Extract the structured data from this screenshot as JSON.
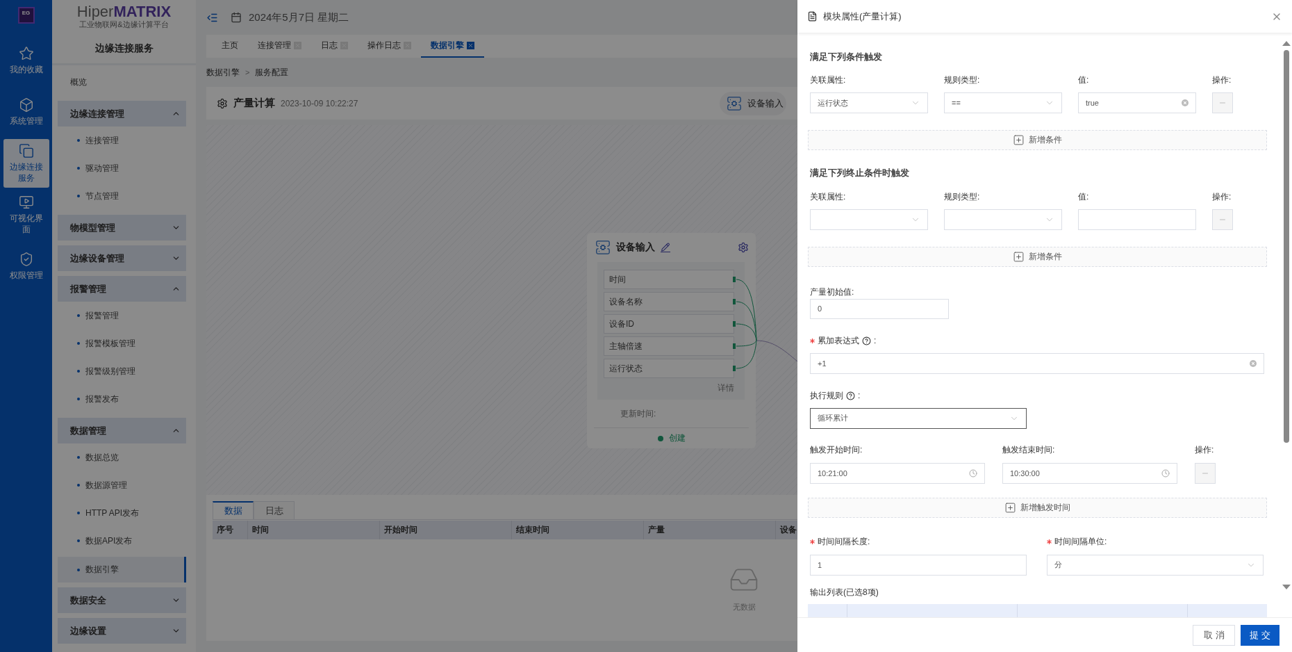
{
  "rail": {
    "logo": "EG",
    "items": [
      {
        "label": "我的收藏",
        "selected": false
      },
      {
        "label": "系统管理",
        "selected": false
      },
      {
        "label": "边缘连接服务",
        "selected": true
      },
      {
        "label": "可视化界面",
        "selected": false
      },
      {
        "label": "权限管理",
        "selected": false
      }
    ]
  },
  "sidebar": {
    "brand": "Hiper**MATRIX**",
    "subtitle": "工业物联网&边缘计算平台",
    "title": "边缘连接服务",
    "items": [
      {
        "kind": "link",
        "label": "概览"
      },
      {
        "kind": "group",
        "label": "边缘连接管理",
        "expanded": true,
        "children": [
          {
            "label": "连接管理",
            "selected": false
          },
          {
            "label": "驱动管理",
            "selected": false
          },
          {
            "label": "节点管理",
            "selected": false
          }
        ]
      },
      {
        "kind": "group",
        "label": "物模型管理",
        "expanded": false
      },
      {
        "kind": "group",
        "label": "边缘设备管理",
        "expanded": false
      },
      {
        "kind": "group",
        "label": "报警管理",
        "expanded": true,
        "children": [
          {
            "label": "报警管理",
            "selected": false
          },
          {
            "label": "报警模板管理",
            "selected": false
          },
          {
            "label": "报警级别管理",
            "selected": false
          },
          {
            "label": "报警发布",
            "selected": false
          }
        ]
      },
      {
        "kind": "group",
        "label": "数据管理",
        "expanded": true,
        "children": [
          {
            "label": "数据总览",
            "selected": false
          },
          {
            "label": "数据源管理",
            "selected": false
          },
          {
            "label": "HTTP API发布",
            "selected": false
          },
          {
            "label": "数据API发布",
            "selected": false
          },
          {
            "label": "数据引擎",
            "selected": true
          }
        ]
      },
      {
        "kind": "group",
        "label": "数据安全",
        "expanded": false
      },
      {
        "kind": "group",
        "label": "边缘设置",
        "expanded": false
      }
    ]
  },
  "topbar": {
    "date": "2024年5月7日 星期二"
  },
  "tabs": [
    {
      "label": "主页",
      "closable": false,
      "selected": false
    },
    {
      "label": "连接管理",
      "closable": true,
      "selected": false
    },
    {
      "label": "日志",
      "closable": true,
      "selected": false
    },
    {
      "label": "操作日志",
      "closable": true,
      "selected": false
    },
    {
      "label": "数据引擎",
      "closable": true,
      "selected": true
    }
  ],
  "breadcrumb": {
    "items": [
      "数据引擎",
      "服务配置"
    ],
    "separator": ">"
  },
  "module": {
    "title": "产量计算",
    "time": "2023-10-09 10:22:27",
    "action": "设备输入"
  },
  "node": {
    "title": "设备输入",
    "fields": [
      "时间",
      "设备名称",
      "设备ID",
      "主轴倍速",
      "运行状态"
    ],
    "detail": "详情",
    "update_label": "更新时间:",
    "status": "创建"
  },
  "bottom": {
    "tabs": [
      {
        "label": "数据",
        "selected": true
      },
      {
        "label": "日志",
        "selected": false
      }
    ],
    "columns": [
      "序号",
      "时间",
      "开始时间",
      "结束时间",
      "产量",
      "设备"
    ],
    "empty": "无数据"
  },
  "drawer": {
    "title": "模块属性(产量计算)",
    "trigger": {
      "title": "满足下列条件触发",
      "headers": [
        "关联属性:",
        "规则类型:",
        "值:",
        "操作:"
      ],
      "rows": [
        {
          "attribute": "运行状态",
          "rule": "==",
          "value": "true"
        }
      ],
      "add": "新增条件"
    },
    "stop": {
      "title": "满足下列终止条件时触发",
      "headers": [
        "关联属性:",
        "规则类型:",
        "值:",
        "操作:"
      ],
      "rows": [
        {}
      ],
      "add": "新增条件"
    },
    "initial": {
      "label": "产量初始值:",
      "value": "0"
    },
    "expression": {
      "label": "累加表达式",
      "required": true,
      "help": true,
      "colon": ":",
      "value": "+1"
    },
    "rule": {
      "label": "执行规则",
      "required": false,
      "help": true,
      "colon": ":",
      "value": "循环累计"
    },
    "times": {
      "headers": [
        "触发开始时间:",
        "触发结束时间:",
        "操作:"
      ],
      "rows": [
        {
          "start": "10:21:00",
          "end": "10:30:00"
        }
      ],
      "add": "新增触发时间"
    },
    "interval": [
      {
        "kind": "input",
        "label": "时间间隔长度:",
        "required": true,
        "value": "1"
      },
      {
        "kind": "select",
        "label": "时间间隔单位:",
        "required": true,
        "value": "分"
      }
    ],
    "output": {
      "label": "输出列表(已选8项)"
    },
    "buttons": [
      {
        "label": "取消",
        "kind": "secondary"
      },
      {
        "label": "提交",
        "kind": "primary"
      }
    ]
  }
}
